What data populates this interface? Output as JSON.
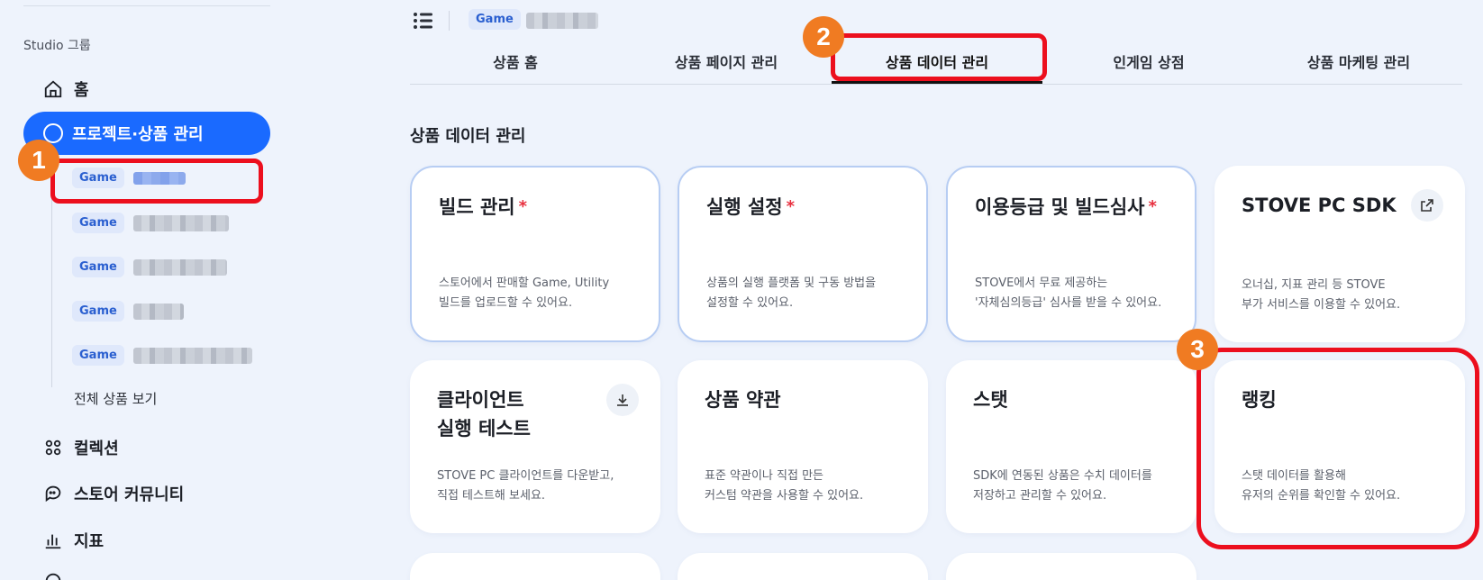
{
  "sidebar": {
    "group_label": "Studio 그룹",
    "home_label": "홈",
    "active_label": "프로젝트·상품 관리",
    "games": [
      {
        "tag": "Game"
      },
      {
        "tag": "Game"
      },
      {
        "tag": "Game"
      },
      {
        "tag": "Game"
      },
      {
        "tag": "Game"
      }
    ],
    "all_products_label": "전체 상품 보기",
    "collection_label": "컬렉션",
    "community_label": "스토어 커뮤니티",
    "stats_label": "지표"
  },
  "header": {
    "game_tag": "Game"
  },
  "tabs": [
    {
      "label": "상품 홈"
    },
    {
      "label": "상품 페이지 관리"
    },
    {
      "label": "상품 데이터 관리"
    },
    {
      "label": "인게임 상점"
    },
    {
      "label": "상품 마케팅 관리"
    }
  ],
  "section_title": "상품 데이터 관리",
  "cards": [
    {
      "title": "빌드 관리",
      "required": "*",
      "desc_line1": "스토어에서 판매할 Game, Utility",
      "desc_line2": "빌드를 업로드할 수 있어요."
    },
    {
      "title": "실행 설정",
      "required": "*",
      "desc_line1": "상품의 실행 플랫폼 및 구동 방법을",
      "desc_line2": "설정할 수 있어요."
    },
    {
      "title": "이용등급 및 빌드심사",
      "required": "*",
      "desc_line1": "STOVE에서 무료 제공하는",
      "desc_line2": "'자체심의등급' 심사를 받을 수 있어요."
    },
    {
      "title": "STOVE PC SDK",
      "desc_line1": "오너십, 지표 관리 등 STOVE",
      "desc_line2": "부가 서비스를 이용할 수 있어요."
    },
    {
      "title_line1": "클라이언트",
      "title_line2": "실행 테스트",
      "desc_line1": "STOVE PC 클라이언트를 다운받고,",
      "desc_line2": "직접 테스트해 보세요."
    },
    {
      "title": "상품 약관",
      "desc_line1": "표준 약관이나 직접 만든",
      "desc_line2": "커스텀 약관을 사용할 수 있어요."
    },
    {
      "title": "스탯",
      "desc_line1": "SDK에 연동된 상품은 수치 데이터를",
      "desc_line2": "저장하고 관리할 수 있어요."
    },
    {
      "title": "랭킹",
      "desc_line1": "스탯 데이터를 활용해",
      "desc_line2": "유저의 순위를 확인할 수 있어요."
    }
  ],
  "annotations": {
    "badge1": "1",
    "badge2": "2",
    "badge3": "3"
  },
  "colors": {
    "accent": "#1a6aff",
    "highlight": "#ec0f1e",
    "badge": "#f07b22",
    "background": "#eef3fc"
  }
}
